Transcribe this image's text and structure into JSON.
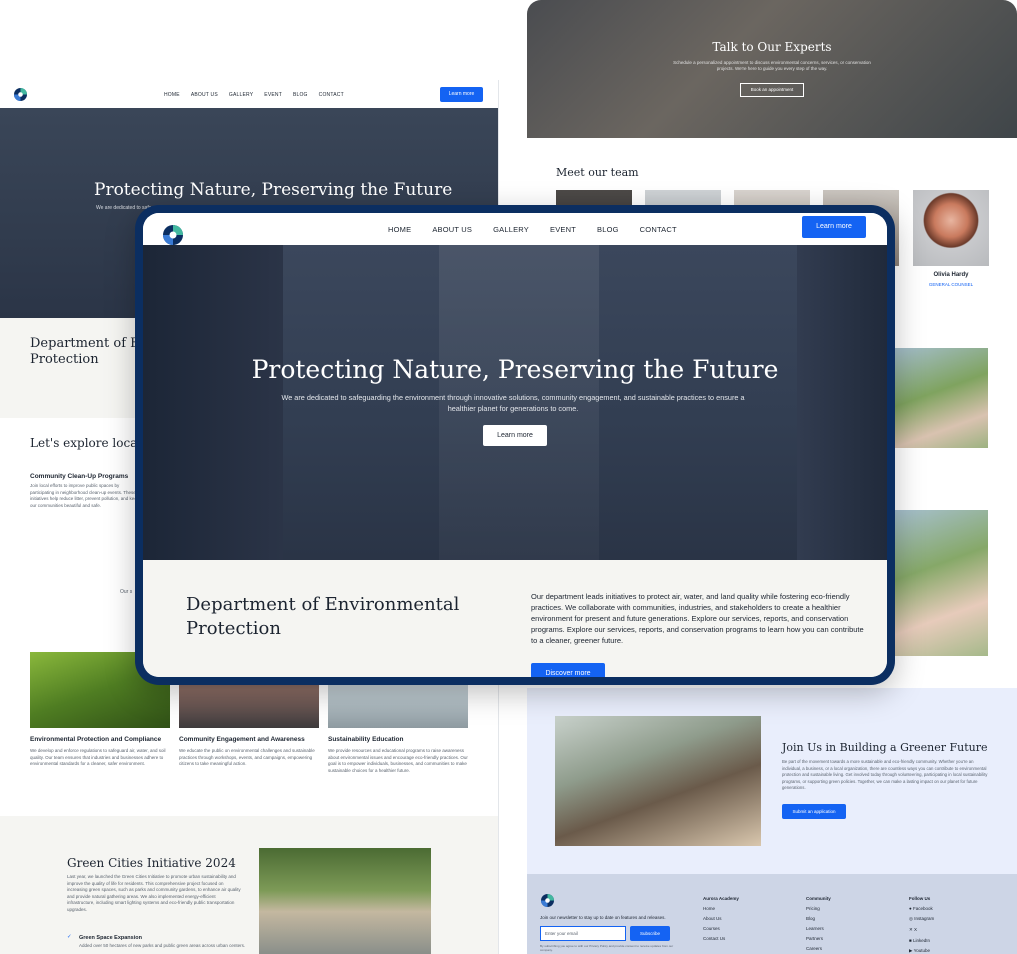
{
  "brand": {
    "accent": "#1463f3",
    "navy": "#0b2e61"
  },
  "nav": {
    "items": [
      "HOME",
      "ABOUT US",
      "GALLERY",
      "EVENT",
      "BLOG",
      "CONTACT"
    ],
    "cta": "Learn more"
  },
  "hero": {
    "title": "Protecting Nature, Preserving the Future",
    "subtitle": "We are dedicated to safeguarding the environment through innovative solutions, community engagement, and sustainable practices to ensure a healthier planet for generations to come.",
    "cta": "Learn more"
  },
  "left_hero_snippet": "We are dedicated to safe",
  "dept": {
    "title": "Department of Environmental Protection",
    "left_title": "Department of En Protection",
    "body": "Our department leads initiatives to protect air, water, and land quality while fostering eco-friendly practices. We collaborate with communities, industries, and stakeholders to create a healthier environment for present and future generations. Explore our services, reports, and conservation programs. Explore our services, reports, and conservation programs to learn how you can contribute to a cleaner, greener future.",
    "cta": "Discover more"
  },
  "explore": "Let's explore local se",
  "program": {
    "title": "Community Clean-Up Programs",
    "text": "Join local efforts to improve public spaces by participating in neighborhood clean-up events. These initiatives help reduce litter, prevent pollution, and keep our communities beautiful and safe."
  },
  "our_snippet": "Our s",
  "cards": [
    {
      "title": "Environmental Protection and Compliance",
      "text": "We develop and enforce regulations to safeguard air, water, and soil quality. Our team ensures that industries and businesses adhere to environmental standards for a cleaner, safer environment."
    },
    {
      "title": "Community Engagement and Awareness",
      "text": "We educate the public on environmental challenges and sustainable practices through workshops, events, and campaigns, empowering citizens to take meaningful action."
    },
    {
      "title": "Sustainability Education",
      "text": "We provide resources and educational programs to raise awareness about environmental issues and encourage eco-friendly practices. Our goal is to empower individuals, businesses, and communities to make sustainable choices for a healthier future."
    }
  ],
  "green": {
    "title": "Green Cities Initiative 2024",
    "text": "Last year, we launched the Green Cities Initiative to promote urban sustainability and improve the quality of life for residents. This comprehensive project focused on increasing green spaces, such as parks and community gardens, to enhance air quality and provide natural gathering areas. We also implemented energy-efficient infrastructure, including smart lighting systems and eco-friendly public transportation upgrades.",
    "check_title": "Green Space Expansion",
    "check_text": "Added over 50 hectares of new parks and public green areas across urban centers."
  },
  "experts": {
    "title": "Talk to Our Experts",
    "text": "Schedule a personalized appointment to discuss environmental concerns, services, or conservation projects. We're here to guide you every step of the way.",
    "cta": "Book an appointment"
  },
  "team": {
    "title": "Meet our team",
    "featured_name": "Olivia Hardy",
    "featured_role": "GENERAL COUNSEL"
  },
  "join": {
    "title": "Join Us in Building a Greener Future",
    "text": "Be part of the movement towards a more sustainable and eco-friendly community. Whether you're an individual, a business, or a local organization, there are countless ways you can contribute to environmental protection and sustainable living. Get involved today through volunteering, participating in local sustainability programs, or supporting green policies. Together, we can make a lasting impact on our planet for future generations.",
    "cta": "Submit an application"
  },
  "footer": {
    "newsletter": "Join our newsletter to stay up to date on features and releases.",
    "placeholder": "Enter your email",
    "subscribe": "Subscribe",
    "fine": "By subscribing you agree to with our Privacy Policy and provide consent to receive updates from our company.",
    "col1": {
      "title": "Aurora Academy",
      "items": [
        "Home",
        "About Us",
        "Courses",
        "Contact Us"
      ]
    },
    "col2": {
      "title": "Community",
      "items": [
        "Pricing",
        "Blog",
        "Learners",
        "Partners",
        "Careers"
      ]
    },
    "col3": {
      "title": "Follow Us",
      "items": [
        "Facebook",
        "Instagram",
        "X",
        "LinkedIn",
        "Youtube"
      ]
    }
  }
}
